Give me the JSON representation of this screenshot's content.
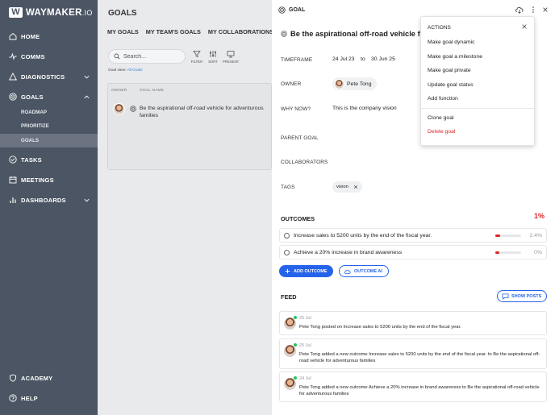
{
  "brand": {
    "name": "WAYMAKER",
    "suffix": ".IO"
  },
  "sidebar": {
    "items": [
      {
        "label": "HOME",
        "icon": "home-icon"
      },
      {
        "label": "COMMS",
        "icon": "pulse-icon"
      },
      {
        "label": "DIAGNOSTICS",
        "icon": "triangle-icon"
      },
      {
        "label": "GOALS",
        "icon": "target-icon"
      },
      {
        "label": "TASKS",
        "icon": "check-circle-icon"
      },
      {
        "label": "MEETINGS",
        "icon": "calendar-icon"
      },
      {
        "label": "DASHBOARDS",
        "icon": "bar-chart-icon"
      }
    ],
    "goals_sub": [
      "ROADMAP",
      "PRIORITIZE",
      "GOALS"
    ],
    "academy": "ACADEMY",
    "help": "HELP"
  },
  "middle": {
    "title": "GOALS",
    "tabs": [
      "MY GOALS",
      "MY TEAM'S GOALS",
      "MY COLLABORATIONS"
    ],
    "search_placeholder": "Search...",
    "tools": [
      "FILTER",
      "SORT",
      "PRESENT"
    ],
    "goal_view_label": "Goal view:",
    "goal_view_value": "All Goals",
    "columns": [
      "OWNER",
      "GOAL NAME"
    ],
    "rows": [
      {
        "name": "Be the aspirational off-road vehicle for adventurous families"
      }
    ]
  },
  "detail": {
    "header": "GOAL",
    "goal_name": "Be the aspirational off-road vehicle for ad",
    "timeframe_label": "TIMEFRAME",
    "start": "24 Jul 23",
    "to": "to",
    "end": "30 Jun 25",
    "owner_label": "OWNER",
    "owner": "Pete Tong",
    "why_label": "WHY NOW?",
    "why": "This is the company vision",
    "parent_label": "PARENT GOAL",
    "collab_label": "COLLABORATORS",
    "tags_label": "TAGS",
    "tags": [
      "vision"
    ],
    "outcomes_title": "OUTCOMES",
    "outcomes_pct": "1%",
    "outcomes": [
      {
        "text": "Increase sales to 5200 units by the end of the fiscal year.",
        "value": "2.4%",
        "progress": 0.18
      },
      {
        "text": "Achieve a 20% increase in brand awareness",
        "value": "0%",
        "progress": 0.15
      }
    ],
    "add_outcome": "ADD OUTCOME",
    "outcome_ai": "OUTCOME AI",
    "feed_title": "FEED",
    "show_posts": "SHOW POSTS",
    "feed": [
      {
        "date": "25 Jul",
        "text": "Pete Tong posted on Increase sales to 5200 units by the end of the fiscal year."
      },
      {
        "date": "25 Jul",
        "text": "Pete Tong added a new outcome Increase sales to 5200 units by the end of the fiscal year. to Be the aspirational off-road vehicle for adventurous families"
      },
      {
        "date": "24 Jul",
        "text": "Pete Tong added a new outcome Achieve a 20% increase in brand awareness to Be the aspirational off-road vehicle for adventurous families"
      }
    ]
  },
  "actions": {
    "title": "ACTIONS",
    "items": [
      "Make goal dynamic",
      "Make goal a milestone",
      "Make goal private",
      "Update goal status",
      "Add function"
    ],
    "items2": [
      "Clone goal",
      "Delete goal"
    ],
    "danger_color": "#dc2626"
  },
  "colors": {
    "sidebar": "#4b5563",
    "accent": "#2563eb",
    "danger": "#dc2626"
  }
}
